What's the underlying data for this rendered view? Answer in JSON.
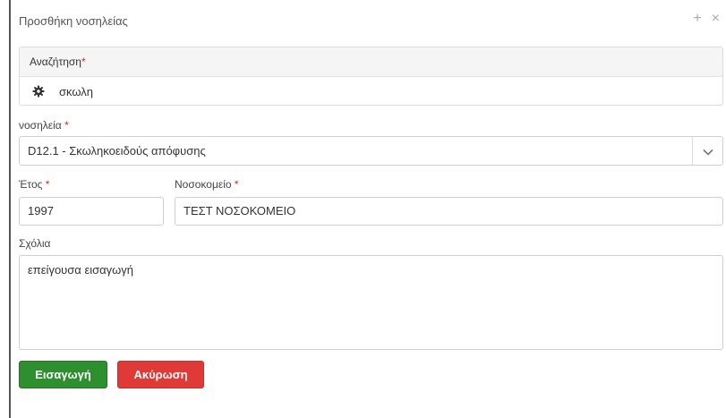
{
  "modal": {
    "title": "Προσθήκη νοσηλείας",
    "expand_glyph": "+",
    "close_glyph": "×"
  },
  "search": {
    "label": "Αναζήτηση",
    "value": "σκωλη",
    "icon": "gear-icon"
  },
  "fields": {
    "required_mark": "*",
    "hospitalization_label": "νοσηλεία",
    "hospitalization_value": "D12.1 - Σκωληκοειδούς απόφυσης",
    "year_label": "Έτος",
    "year_value": "1997",
    "hospital_label": "Νοσοκομείο",
    "hospital_value": "ΤΕΣΤ ΝΟΣΟΚΟΜΕΙΟ",
    "comments_label": "Σχόλια",
    "comments_value": "επείγουσα εισαγωγή"
  },
  "buttons": {
    "submit_label": "Εισαγωγή",
    "cancel_label": "Ακύρωση"
  },
  "colors": {
    "submit": "#2e8f2e",
    "cancel": "#e03a37",
    "required": "#e02424"
  }
}
